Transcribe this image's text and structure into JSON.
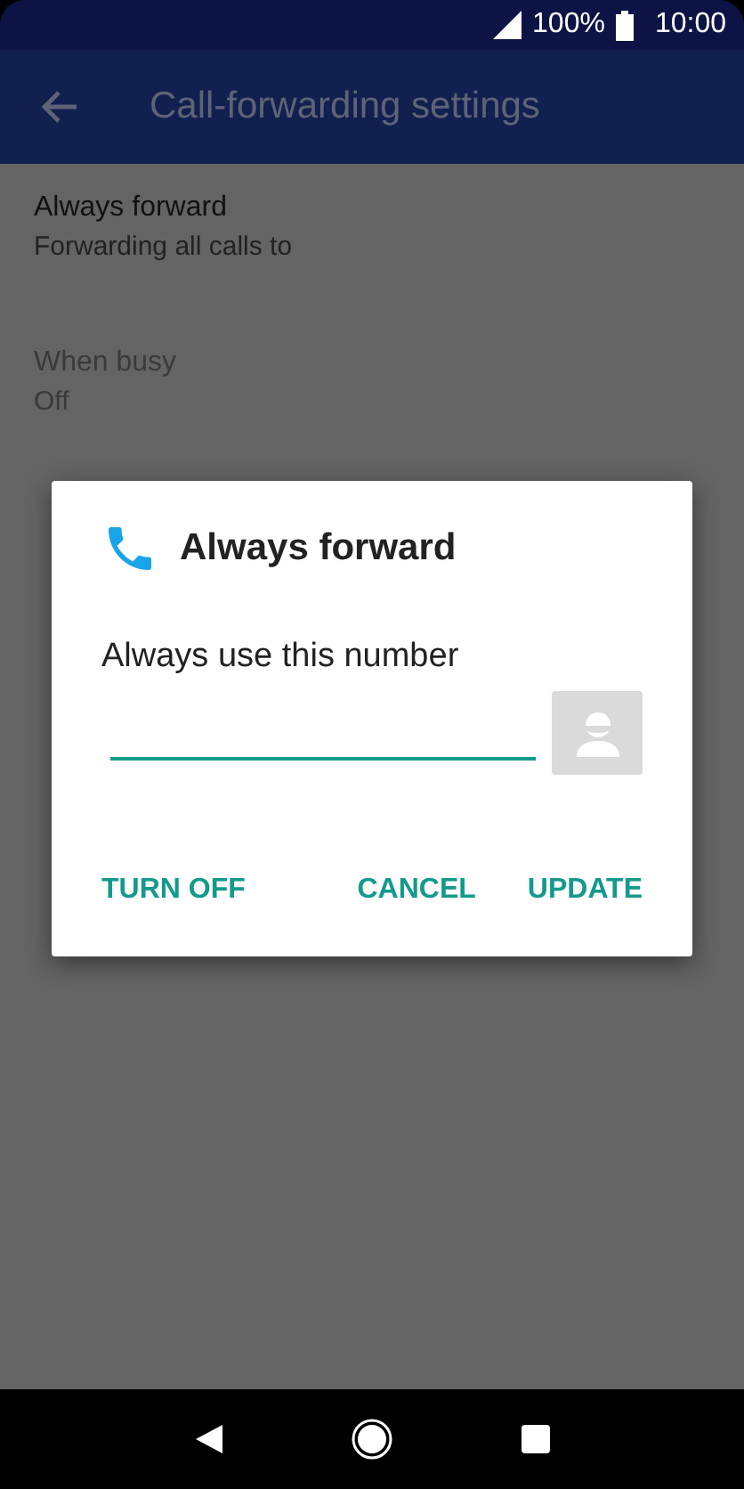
{
  "status_bar": {
    "battery": "100%",
    "time": "10:00"
  },
  "app_bar": {
    "title": "Call-forwarding settings"
  },
  "items": [
    {
      "title": "Always forward",
      "subtitle": "Forwarding all calls to",
      "disabled": false
    },
    {
      "title": "When busy",
      "subtitle": "Off",
      "disabled": true
    }
  ],
  "dialog": {
    "title": "Always forward",
    "label": "Always use this number",
    "buttons": [
      {
        "label": "TURN OFF"
      },
      {
        "label": "CANCEL"
      },
      {
        "label": "UPDATE"
      }
    ]
  }
}
